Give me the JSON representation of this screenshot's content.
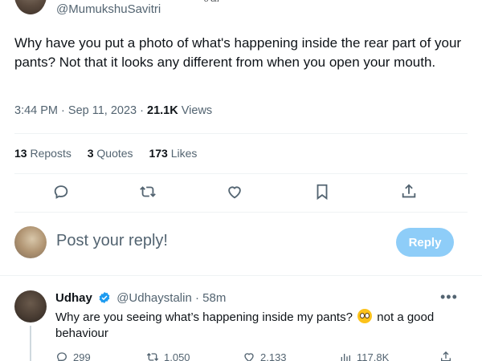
{
  "tweet": {
    "author_handle": "@MumukshuSavitri",
    "author_name_fragment": "சவ",
    "text": "Why have you put a photo of what's happening inside the rear part of your pants? Not that it looks any different from when you open your mouth.",
    "time": "3:44 PM",
    "date": "Sep 11, 2023",
    "meta_separator": "·",
    "views_count": "21.1K",
    "views_label": "Views",
    "stats": {
      "reposts_count": "13",
      "reposts_label": "Reposts",
      "quotes_count": "3",
      "quotes_label": "Quotes",
      "likes_count": "173",
      "likes_label": "Likes"
    },
    "actions": [
      "reply-icon",
      "repost-icon",
      "like-icon",
      "bookmark-icon",
      "share-icon"
    ]
  },
  "composer": {
    "placeholder": "Post your reply!",
    "reply_button_label": "Reply",
    "reply_button_color": "#8ecdf8"
  },
  "reply": {
    "name": "Udhay",
    "handle": "@Udhaystalin",
    "separator": "·",
    "time": "58m",
    "text_before_emoji": "Why are you seeing what’s happening inside my pants?",
    "text_after_emoji": "not a good behaviour",
    "emoji": "flushed-face-emoji",
    "verified_color": "#1d9bf0",
    "counts": {
      "replies": "299",
      "reposts": "1,050",
      "likes": "2,133",
      "views": "117.8K"
    }
  },
  "colors": {
    "text_primary": "#0f1419",
    "text_secondary": "#536471",
    "divider": "#eff3f4",
    "accent": "#1d9bf0"
  }
}
